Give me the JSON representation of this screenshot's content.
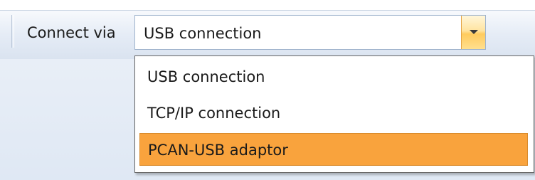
{
  "toolbar": {
    "connect_label": "Connect via"
  },
  "combo": {
    "value": "USB connection",
    "arrow_icon": "chevron-down-icon",
    "arrow_color": "#ffcb5e"
  },
  "dropdown": {
    "options": [
      {
        "label": "USB connection"
      },
      {
        "label": "TCP/IP connection"
      },
      {
        "label": "PCAN-USB adaptor",
        "highlighted": true
      }
    ],
    "highlight_color": "#f9a33d"
  }
}
